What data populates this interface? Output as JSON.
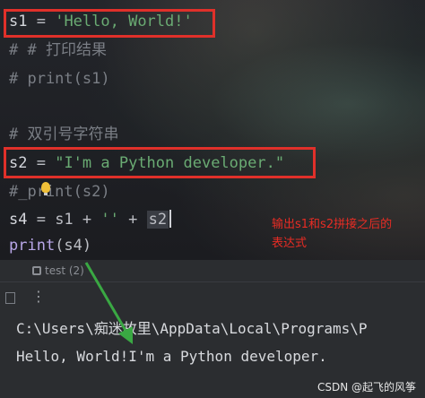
{
  "editor": {
    "lines": [
      {
        "var": "s1",
        "op": " = ",
        "str": "'Hello, World!'"
      },
      {
        "comment": "# # 打印结果"
      },
      {
        "comment": "# print(s1)"
      },
      {
        "blank": ""
      },
      {
        "comment": "# 双引号字符串"
      },
      {
        "var": "s2",
        "op": " = ",
        "str": "\"I'm a Python developer.\""
      },
      {
        "comment": "#_print(s2)"
      },
      {
        "s4_var": "s4",
        "s4_mid": " = s1 + ",
        "s4_str": "''",
        "s4_plus": " + ",
        "s4_sel": "s2"
      },
      {
        "fn": "print",
        "args": "(s4)"
      }
    ]
  },
  "annotation": {
    "line1": "输出s1和s2拼接之后的",
    "line2": "表达式",
    "color": "#e82c24"
  },
  "run_panel": {
    "tab_label": "test (2)",
    "output_line1": "C:\\Users\\痴迷故里\\AppData\\Local\\Programs\\P",
    "output_line2": "Hello, World!I'm a Python developer."
  },
  "watermark": "CSDN @起飞的风筝",
  "icons": [
    "lightbulb-icon",
    "run-config-icon",
    "more-options-icon",
    "arrow-annotation"
  ]
}
